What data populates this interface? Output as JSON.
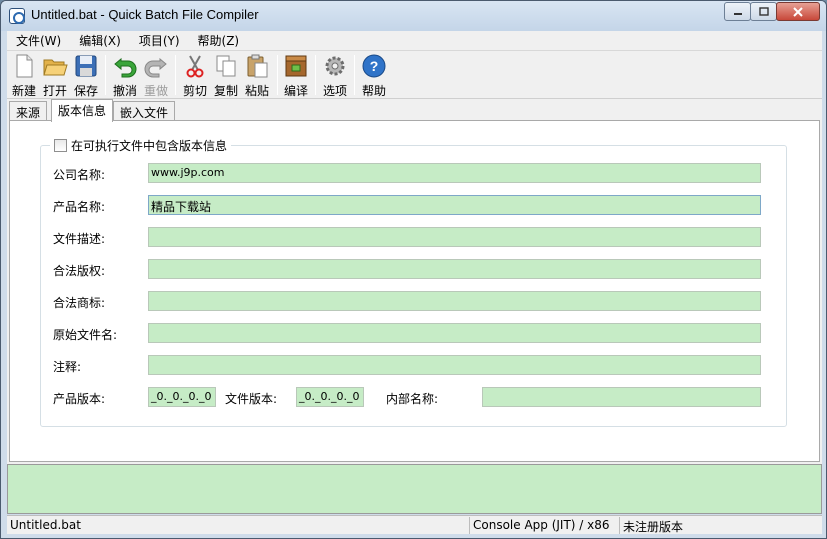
{
  "window": {
    "title": "Untitled.bat - Quick Batch File Compiler"
  },
  "menu": [
    {
      "label": "文件(W)"
    },
    {
      "label": "编辑(X)"
    },
    {
      "label": "项目(Y)"
    },
    {
      "label": "帮助(Z)"
    }
  ],
  "toolbar": {
    "new": "新建",
    "open": "打开",
    "save": "保存",
    "undo": "撤消",
    "redo": "重做",
    "cut": "剪切",
    "copy": "复制",
    "paste": "粘贴",
    "compile": "编译",
    "options": "选项",
    "help": "帮助"
  },
  "tabs": [
    {
      "label": "来源"
    },
    {
      "label": "版本信息"
    },
    {
      "label": "嵌入文件"
    }
  ],
  "version_info": {
    "include_checkbox_label": "在可执行文件中包含版本信息",
    "include_checked": false,
    "company_label": "公司名称:",
    "company_value": "www.j9p.com",
    "product_label": "产品名称:",
    "product_value": "精品下载站",
    "description_label": "文件描述:",
    "description_value": "",
    "copyright_label": "合法版权:",
    "copyright_value": "",
    "trademark_label": "合法商标:",
    "trademark_value": "",
    "original_filename_label": "原始文件名:",
    "original_filename_value": "",
    "comments_label": "注释:",
    "comments_value": "",
    "product_version_label": "产品版本:",
    "product_version_value": "_0._0._0._0",
    "file_version_label": "文件版本:",
    "file_version_value": "_0._0._0._0",
    "internal_name_label": "内部名称:",
    "internal_name_value": ""
  },
  "status": {
    "file": "Untitled.bat",
    "mode": "Console App (JIT) / x86",
    "license": "未注册版本"
  },
  "colors": {
    "field_bg": "#c6ecc6",
    "title_bg": "#c4d5e8",
    "close_btn": "#c8483a"
  },
  "icons": [
    "app-icon",
    "new-file-icon",
    "open-folder-icon",
    "save-disk-icon",
    "undo-icon",
    "redo-icon",
    "scissors-icon",
    "copy-icon",
    "paste-icon",
    "compile-icon",
    "gear-icon",
    "help-icon"
  ]
}
